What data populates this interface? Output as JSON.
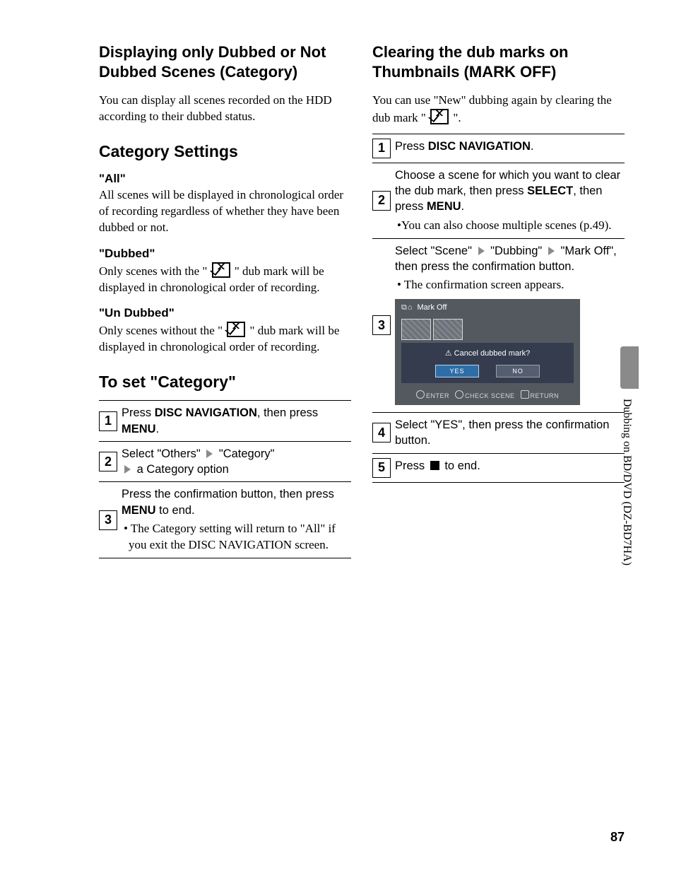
{
  "side_tab": "Dubbing on BD/DVD (DZ-BD7HA)",
  "page_number": "87",
  "left": {
    "heading": "Displaying only Dubbed or Not Dubbed Scenes (Category)",
    "intro": "You can display all scenes recorded on the HDD according to their dubbed status.",
    "sub1_title": "Category Settings",
    "opt_all_head": "\"All\"",
    "opt_all_text": "All scenes will be displayed in chronological order of recording regardless of whether they have been dubbed or not.",
    "opt_dub_head": "\"Dubbed\"",
    "opt_dub_pre": "Only scenes with the \" ",
    "opt_dub_post": " \" dub mark will be displayed in chronological order of recording.",
    "opt_undub_head": "\"Un Dubbed\"",
    "opt_undub_pre": "Only scenes without the \" ",
    "opt_undub_post": " \" dub mark will be displayed in chronological order of recording.",
    "sub2_title": "To set \"Category\"",
    "steps": [
      {
        "n": "1",
        "t1": "Press ",
        "b1": "DISC NAVIGATION",
        "t2": ", then press ",
        "b2": "MENU",
        "t3": "."
      },
      {
        "n": "2",
        "t1": "Select \"Others\" ",
        "t2": " \"Category\" ",
        "t3": " a Category option"
      },
      {
        "n": "3",
        "t1": "Press the confirmation button, then press ",
        "b1": "MENU",
        "t2": " to end.",
        "note": "• The Category setting will return to \"All\" if you exit the DISC NAVIGATION screen."
      }
    ]
  },
  "right": {
    "heading": "Clearing the dub marks on Thumbnails (MARK OFF)",
    "intro_pre": "You can use \"New\" dubbing again by clearing the dub mark \" ",
    "intro_post": " \".",
    "steps": {
      "s1": {
        "n": "1",
        "t1": "Press ",
        "b1": "DISC NAVIGATION",
        "t2": "."
      },
      "s2": {
        "n": "2",
        "line1": "Choose a scene for which you want to clear the dub mark, then press ",
        "b1": "SELECT",
        "mid": ", then press ",
        "b2": "MENU",
        "end": ".",
        "note": "•You can also choose multiple scenes (p.49)."
      },
      "s3": {
        "n": "3",
        "seg1": "Select \"Scene\" ",
        "seg2": " \"Dubbing\" ",
        "seg3": " \"Mark Off\", then press the confirmation button.",
        "note": "• The confirmation screen appears.",
        "screen": {
          "title": "Mark Off",
          "question": "Cancel dubbed mark?",
          "warn_icon": "⚠",
          "yes": "YES",
          "no": "NO",
          "f1": "ENTER",
          "f2": "CHECK SCENE",
          "f3": "RETURN"
        }
      },
      "s4": {
        "n": "4",
        "text": "Select \"YES\", then press the confirmation button."
      },
      "s5": {
        "n": "5",
        "t1": "Press ",
        "t2": " to end."
      }
    }
  }
}
